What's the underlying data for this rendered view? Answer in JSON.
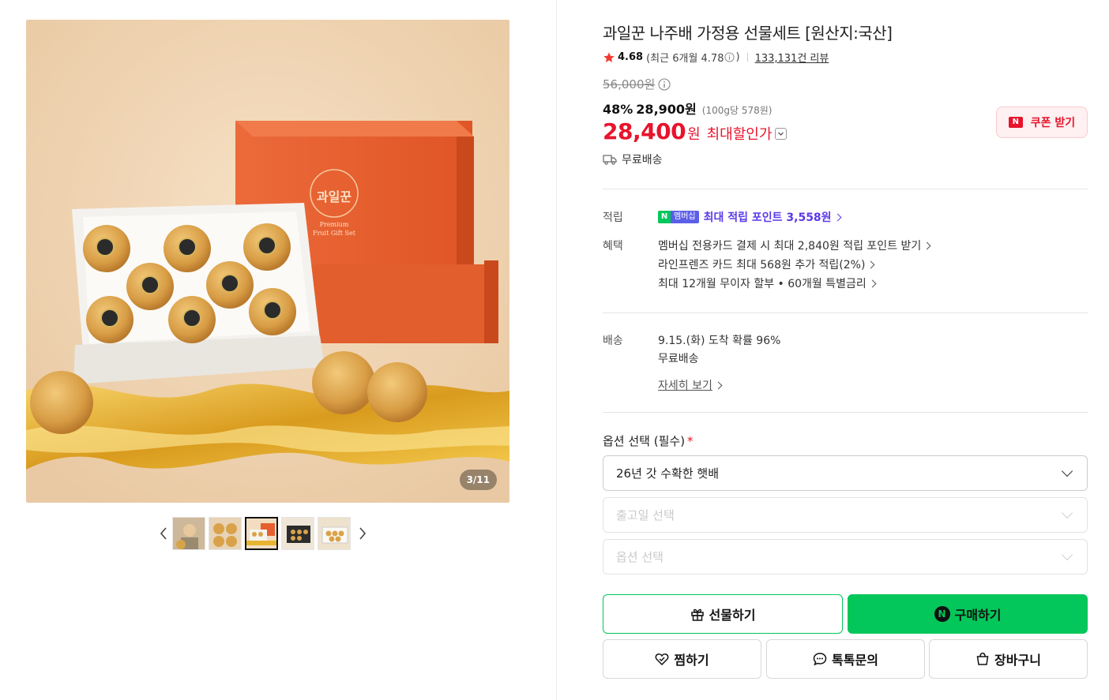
{
  "gallery": {
    "counter": "3/11",
    "thumbnails": [
      {
        "name": "thumb-1"
      },
      {
        "name": "thumb-2"
      },
      {
        "name": "thumb-3",
        "active": true
      },
      {
        "name": "thumb-4"
      },
      {
        "name": "thumb-5"
      }
    ],
    "box_logo": "과일꾼",
    "box_sub": "Premium Fruit Gift Set"
  },
  "product": {
    "title": "과일꾼 나주배 가정용 선물세트 [원산지:국산]",
    "rating": "4.68",
    "rating_recent": "(최근 6개월 4.78",
    "rating_recent_close": ")",
    "reviews": "133,131건 리뷰",
    "original_price": "56,000원",
    "discount_rate": "48%",
    "sale_price": "28,900원",
    "unit_price": "(100g당 578원)",
    "max_price": "28,400",
    "max_price_won": "원",
    "max_price_label": "최대할인가",
    "coupon_label": "쿠폰 받기",
    "coupon_badge": "N",
    "shipping": "무료배송"
  },
  "benefits": {
    "points_label": "적립",
    "points_badge_n": "N",
    "points_badge_m": "멤버십",
    "points_text": "최대 적립 포인트 3,558원",
    "perks_label": "혜택",
    "perks": [
      "멤버십 전용카드 결제 시 최대 2,840원 적립 포인트 받기",
      "라인프렌즈 카드 최대 568원 추가 적립(2%)",
      "최대 12개월 무이자 할부 • 60개월 특별금리"
    ]
  },
  "delivery": {
    "label": "배송",
    "arrival": "9.15.(화) 도착 확률 96%",
    "fee": "무료배송",
    "details_link": "자세히 보기"
  },
  "options": {
    "title": "옵션 선택 (필수)",
    "required_mark": "*",
    "selected": "26년 갓 수확한 햇배",
    "ship_date_placeholder": "출고일 선택",
    "option_placeholder": "옵션 선택"
  },
  "actions": {
    "gift": "선물하기",
    "buy": "구매하기",
    "buy_badge": "N",
    "wish": "찜하기",
    "talk": "톡톡문의",
    "cart": "장바구니"
  },
  "colors": {
    "accent_green": "#03c75a",
    "price_red": "#e8132c",
    "point_purple": "#5b3ae8"
  }
}
